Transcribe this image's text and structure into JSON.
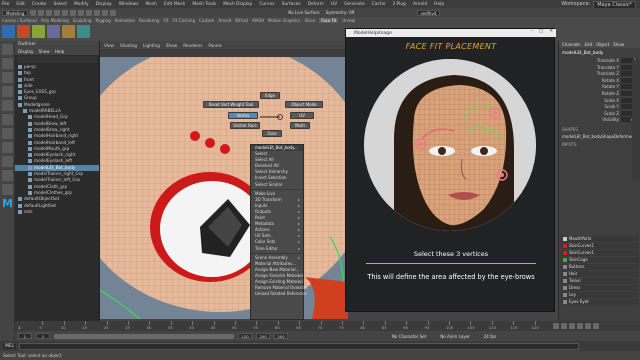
{
  "menubar": {
    "items": [
      "File",
      "Edit",
      "Create",
      "Select",
      "Modify",
      "Display",
      "Windows",
      "Mesh",
      "Edit Mesh",
      "Mesh Tools",
      "Mesh Display",
      "Curves",
      "Surfaces",
      "Deform",
      "UV",
      "Generate",
      "Cache",
      "3 Plug",
      "Arnold",
      "Help"
    ],
    "workspace_label": "Workspace:",
    "workspace_value": "Maya Classic*"
  },
  "statusline": {
    "mode": "Modeling",
    "no_live": "No Live Surface",
    "symmetry": "Symmetry: Off",
    "camera": "sedfkvd"
  },
  "shelf": {
    "tabs": [
      "Curves / Surfaces",
      "Poly Modeling",
      "Sculpting",
      "Rigging",
      "Animation",
      "Rendering",
      "FX",
      "FX Caching",
      "Custom",
      "Arnold",
      "Bifrost",
      "MASH",
      "Motion Graphics",
      "XGen",
      "Face Fit",
      "Unreal"
    ],
    "active_tab": "Face Fit"
  },
  "outliner": {
    "title": "Outliner",
    "menus": [
      "Display",
      "Show",
      "Help"
    ],
    "items": [
      {
        "label": "persp",
        "indent": 0,
        "selected": false
      },
      {
        "label": "top",
        "indent": 0,
        "selected": false
      },
      {
        "label": "front",
        "indent": 0,
        "selected": false
      },
      {
        "label": "side",
        "indent": 0,
        "selected": false
      },
      {
        "label": "Eyes_EXES_grp",
        "indent": 0,
        "selected": false
      },
      {
        "label": "Group",
        "indent": 0,
        "selected": false
      },
      {
        "label": "ModelIgnore",
        "indent": 0,
        "selected": false
      },
      {
        "label": "modelRABELLA",
        "indent": 1,
        "selected": false
      },
      {
        "label": "modelHead_Grp",
        "indent": 2,
        "selected": false
      },
      {
        "label": "modelBrow_left",
        "indent": 2,
        "selected": false
      },
      {
        "label": "modelBrow_right",
        "indent": 2,
        "selected": false
      },
      {
        "label": "modelHairband_right",
        "indent": 2,
        "selected": false
      },
      {
        "label": "modelHairband_left",
        "indent": 2,
        "selected": false
      },
      {
        "label": "modelMouth_grp",
        "indent": 2,
        "selected": false
      },
      {
        "label": "modelEyelash_right",
        "indent": 2,
        "selected": false
      },
      {
        "label": "modelEyelash_left",
        "indent": 2,
        "selected": false
      },
      {
        "label": "modelLEt_Bot_body",
        "indent": 2,
        "selected": true
      },
      {
        "label": "modelTrainer_right_Grp",
        "indent": 2,
        "selected": false
      },
      {
        "label": "modelTrainer_left_Grp",
        "indent": 2,
        "selected": false
      },
      {
        "label": "modelCloth_grp",
        "indent": 2,
        "selected": false
      },
      {
        "label": "modelClothes_grp",
        "indent": 2,
        "selected": false
      },
      {
        "label": "defaultObjectSet",
        "indent": 0,
        "selected": false
      },
      {
        "label": "defaultLightSet",
        "indent": 0,
        "selected": false
      },
      {
        "label": "sets",
        "indent": 0,
        "selected": false
      }
    ]
  },
  "viewport": {
    "menus": [
      "View",
      "Shading",
      "Lighting",
      "Show",
      "Renderer",
      "Panels"
    ],
    "marking_menu": {
      "top": "Edge",
      "left_top": "Reset Vert Weight Tool",
      "right_top": "Object Mode",
      "left": "Vertex",
      "right": "UV",
      "left_bottom": "Visible Face",
      "right_bottom": "Multi",
      "bottom": "Face"
    },
    "context_menu": {
      "header": "modelLEt_Bot_body...",
      "items": [
        {
          "label": "Select",
          "sub": false
        },
        {
          "label": "Select All",
          "sub": false
        },
        {
          "label": "Deselect All",
          "sub": false
        },
        {
          "label": "Select Hierarchy",
          "sub": false
        },
        {
          "label": "Invert Selection",
          "sub": false
        },
        {
          "label": "Select Similar",
          "sub": false
        },
        {
          "label": "Make Live",
          "sub": false
        },
        {
          "label": "3D Transform",
          "sub": true
        },
        {
          "label": "Inputs",
          "sub": true
        },
        {
          "label": "Outputs",
          "sub": true
        },
        {
          "label": "Paint",
          "sub": true
        },
        {
          "label": "Metadata",
          "sub": true
        },
        {
          "label": "Actions",
          "sub": true
        },
        {
          "label": "UV Sets",
          "sub": true
        },
        {
          "label": "Color Sets",
          "sub": true
        },
        {
          "label": "Time Editor",
          "sub": true
        },
        {
          "label": "Scene Assembly",
          "sub": true
        },
        {
          "label": "Material Attributes...",
          "sub": false
        },
        {
          "label": "Assign New Material...",
          "sub": false
        },
        {
          "label": "Assign Favorite Material",
          "sub": true
        },
        {
          "label": "Assign Existing Material",
          "sub": true
        },
        {
          "label": "Remove Material Override",
          "sub": true
        },
        {
          "label": "Unload Related Reference",
          "sub": false
        }
      ]
    }
  },
  "face_fit": {
    "window_title": "ModelHelpImage",
    "heading": "FACE FIT PLACEMENT",
    "caption": "Select these 3 vertices",
    "description": "This will define the area affected by the eye-brows"
  },
  "channelbox": {
    "tabs": [
      "Channels",
      "Edit",
      "Object",
      "Show"
    ],
    "object_name": "modelLEt_Bot_body",
    "attributes": [
      {
        "name": "Translate X",
        "value": "0"
      },
      {
        "name": "Translate Y",
        "value": "0"
      },
      {
        "name": "Translate Z",
        "value": "0"
      },
      {
        "name": "Rotate X",
        "value": "0"
      },
      {
        "name": "Rotate Y",
        "value": "0"
      },
      {
        "name": "Rotate Z",
        "value": "0"
      },
      {
        "name": "Scale X",
        "value": "1"
      },
      {
        "name": "Scale Y",
        "value": "1"
      },
      {
        "name": "Scale Z",
        "value": "1"
      },
      {
        "name": "Visibility",
        "value": "on"
      }
    ],
    "shapes_label": "SHAPES",
    "shape_name": "modelLEt_Bot_bodyShapeDeformed",
    "inputs_label": "INPUTS",
    "layers": [
      {
        "name": "MouthParts",
        "color": "#cccccc"
      },
      {
        "name": "SkinCurves1",
        "color": "#cc2222"
      },
      {
        "name": "SkinCurves1",
        "color": "#cc2222"
      },
      {
        "name": "SkinCage",
        "color": "#44aa44"
      },
      {
        "name": "Buttons",
        "color": "#888888"
      },
      {
        "name": "Hair",
        "color": "#888888"
      },
      {
        "name": "Tuloul",
        "color": "#888888"
      },
      {
        "name": "Dress",
        "color": "#888888"
      },
      {
        "name": "Ley",
        "color": "#888888"
      },
      {
        "name": "Eyes Eyet",
        "color": "#888888"
      }
    ]
  },
  "timeline": {
    "ticks": [
      "5",
      "10",
      "15",
      "20",
      "25",
      "30",
      "35",
      "40",
      "45",
      "50",
      "55",
      "60",
      "65",
      "70",
      "75",
      "80",
      "85",
      "90",
      "95",
      "100",
      "105",
      "110",
      "115",
      "120"
    ],
    "current_frame": "1"
  },
  "range": {
    "start": "1",
    "start_inner": "1",
    "end_inner": "120",
    "end": "200",
    "end2": "200",
    "no_char": "No Character Set",
    "no_anim": "No Anim Layer",
    "fps": "24 fps"
  },
  "cmdline": {
    "lang": "MEL"
  },
  "helpline": {
    "text": "Select Tool: select an object"
  }
}
